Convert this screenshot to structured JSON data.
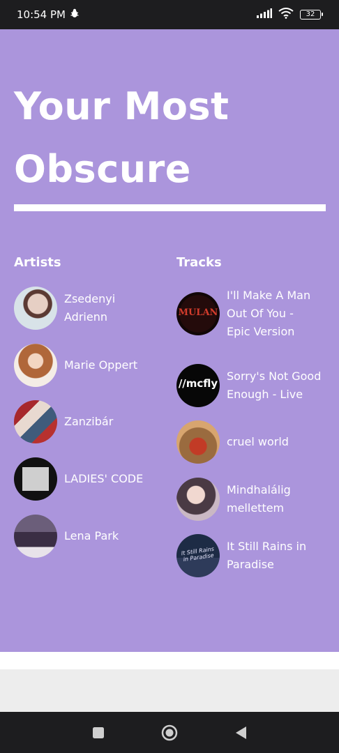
{
  "status_bar": {
    "time": "10:54 PM",
    "battery": "32"
  },
  "card": {
    "headline_line1": "Your Most",
    "headline_line2": "Obscure",
    "background": "#ab95dc",
    "artists": {
      "title": "Artists",
      "items": [
        {
          "line1": "Zsedenyi",
          "line2": "Adrienn"
        },
        {
          "line1": "Marie Oppert",
          "line2": ""
        },
        {
          "line1": "Zanzibár",
          "line2": ""
        },
        {
          "line1": "LADIES' CODE",
          "line2": ""
        },
        {
          "line1": "Lena Park",
          "line2": ""
        }
      ]
    },
    "tracks": {
      "title": "Tracks",
      "items": [
        {
          "line1": "I'll Make A Man",
          "line2": "Out Of You -",
          "line3": "Epic Version",
          "art_text": "MULAN"
        },
        {
          "line1": "Sorry's Not Good",
          "line2": "Enough - Live",
          "line3": "",
          "art_text": "//mcfly"
        },
        {
          "line1": "cruel world",
          "line2": "",
          "line3": "",
          "art_text": ""
        },
        {
          "line1": "Mindhalálig",
          "line2": "mellettem",
          "line3": "",
          "art_text": ""
        },
        {
          "line1": "It Still Rains in",
          "line2": "Paradise",
          "line3": "",
          "art_text": "It Still Rains in Paradise"
        }
      ]
    }
  },
  "icons": {
    "notification": "bug-icon",
    "signal": "signal-bars-icon",
    "wifi": "wifi-icon",
    "nav_recents": "square-icon",
    "nav_home": "circle-icon",
    "nav_back": "triangle-back-icon"
  }
}
